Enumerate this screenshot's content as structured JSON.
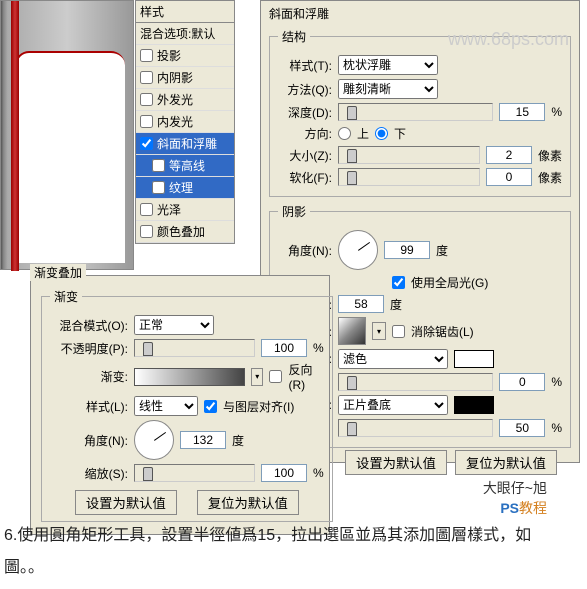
{
  "watermark": "www.68ps.com",
  "styles": {
    "header": "样式",
    "blend_default": "混合选项:默认",
    "items": [
      {
        "label": "投影",
        "checked": false
      },
      {
        "label": "内阴影",
        "checked": false
      },
      {
        "label": "外发光",
        "checked": false
      },
      {
        "label": "内发光",
        "checked": false
      },
      {
        "label": "斜面和浮雕",
        "checked": true,
        "selected": true
      },
      {
        "label": "等高线",
        "checked": false,
        "indent": true,
        "selected": true
      },
      {
        "label": "纹理",
        "checked": false,
        "indent": true,
        "selected": true
      },
      {
        "label": "光泽",
        "checked": false
      },
      {
        "label": "颜色叠加",
        "checked": false
      }
    ]
  },
  "bevel": {
    "title": "斜面和浮雕",
    "structure": {
      "legend": "结构",
      "style_label": "样式(T):",
      "style_val": "枕状浮雕",
      "tech_label": "方法(Q):",
      "tech_val": "雕刻清晰",
      "depth_label": "深度(D):",
      "depth_val": "15",
      "pct": "%",
      "dir_label": "方向:",
      "up": "上",
      "down": "下",
      "size_label": "大小(Z):",
      "size_val": "2",
      "px": "像素",
      "soft_label": "软化(F):",
      "soft_val": "0"
    },
    "shading": {
      "legend": "阴影",
      "angle_label": "角度(N):",
      "angle_val": "99",
      "deg": "度",
      "global": "使用全局光(G)",
      "alt_label": "度:",
      "alt_val": "58",
      "gloss_label": "线:",
      "antialias": "消除锯齿(L)",
      "hmode_label": "(H):",
      "hmode_val": "滤色",
      "opacity_val": "0",
      "smode_label": "(A):",
      "smode_val": "正片叠底",
      "sopacity_val": "50"
    }
  },
  "gradient": {
    "header": "渐变叠加",
    "legend": "渐变",
    "blend_label": "混合模式(O):",
    "blend_val": "正常",
    "opacity_label": "不透明度(P):",
    "opacity_val": "100",
    "pct": "%",
    "grad_label": "渐变:",
    "reverse": "反向(R)",
    "style_label": "样式(L):",
    "style_val": "线性",
    "align": "与图层对齐(I)",
    "angle_label": "角度(N):",
    "angle_val": "132",
    "deg": "度",
    "scale_label": "缩放(S):",
    "scale_val": "100",
    "set_default": "设置为默认值",
    "reset_default": "复位为默认值"
  },
  "logo": {
    "line1": "大眼仔~旭",
    "ps": "PS",
    "jc": "教程"
  },
  "instruction": "6.使用圓角矩形工具，設置半徑値爲15，拉出選區並爲其添加圖層樣式，如圖。。"
}
